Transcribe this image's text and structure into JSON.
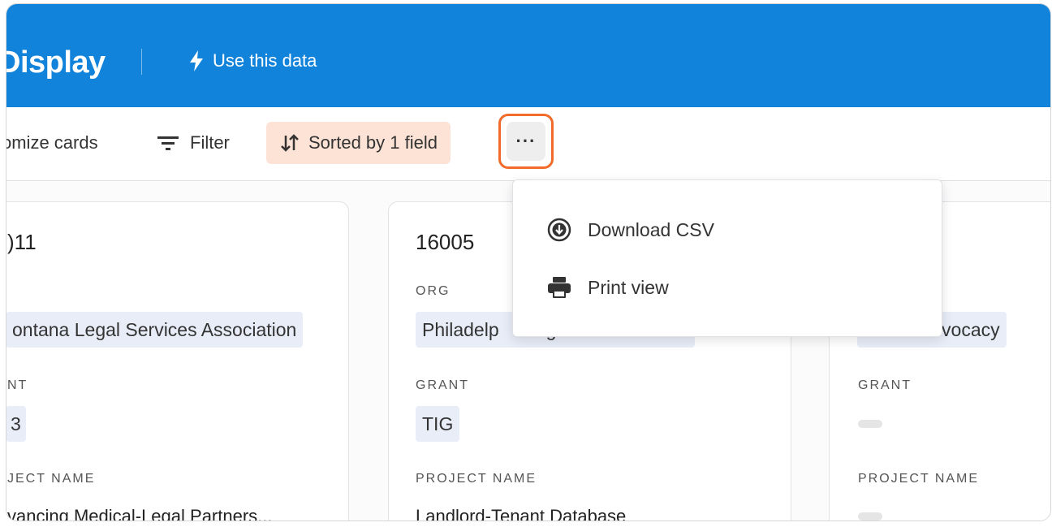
{
  "header": {
    "title": "Display",
    "use_data_label": "Use this data"
  },
  "toolbar": {
    "customize_label": "omize cards",
    "filter_label": "Filter",
    "sort_label": "Sorted by 1 field",
    "more_label": "···"
  },
  "menu": {
    "items": [
      {
        "label": "Download CSV",
        "icon": "download-circle-icon"
      },
      {
        "label": "Print view",
        "icon": "printer-icon"
      }
    ]
  },
  "cards": [
    {
      "id": ")11",
      "org": "ontana Legal Services Association",
      "grant_label": "NT",
      "grant": "3",
      "project_label": "JECT NAME",
      "project": "vancing Medical-Legal Partners..."
    },
    {
      "id": "16005",
      "org_label": "ORG",
      "org": "Philadelp",
      "org_tail": "g",
      "grant_label": "GRANT",
      "grant": "TIG",
      "project_label": "PROJECT NAME",
      "project": "Landlord-Tenant Database"
    },
    {
      "org": "h Advocacy",
      "grant_label": "GRANT",
      "project_label": "PROJECT NAME"
    }
  ],
  "colors": {
    "header_bg": "#1283da",
    "sort_bg": "#fde2d6",
    "highlight_border": "#f26b2a",
    "pill_bg": "#e8edf8"
  }
}
